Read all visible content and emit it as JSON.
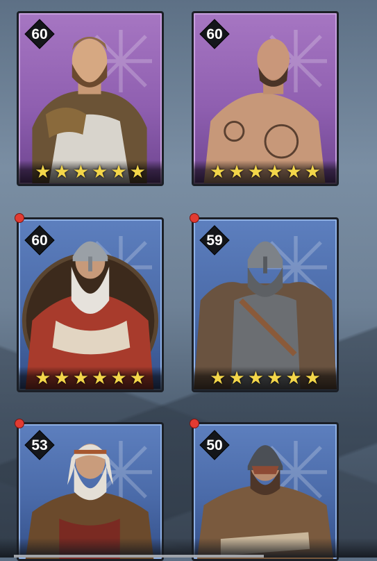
{
  "heroes": [
    {
      "level": "60",
      "rarity": "purple",
      "stars": 6,
      "has_alert": false,
      "icon": "hero-portrait-bearded-warrior"
    },
    {
      "level": "60",
      "rarity": "purple",
      "stars": 6,
      "has_alert": false,
      "icon": "hero-portrait-tattooed-warrior"
    },
    {
      "level": "60",
      "rarity": "blue",
      "stars": 6,
      "has_alert": true,
      "icon": "hero-portrait-old-helmed-warrior"
    },
    {
      "level": "59",
      "rarity": "blue",
      "stars": 6,
      "has_alert": true,
      "icon": "hero-portrait-chainmail-warrior"
    },
    {
      "level": "53",
      "rarity": "blue",
      "stars": 0,
      "has_alert": true,
      "icon": "hero-portrait-elder-warrior"
    },
    {
      "level": "50",
      "rarity": "blue",
      "stars": 0,
      "has_alert": true,
      "icon": "hero-portrait-masked-warrior"
    }
  ],
  "colors": {
    "purple_card": "#8f5fb0",
    "blue_card": "#4a6aa8",
    "star": "#f3d64a",
    "alert_dot": "#e23b32"
  }
}
